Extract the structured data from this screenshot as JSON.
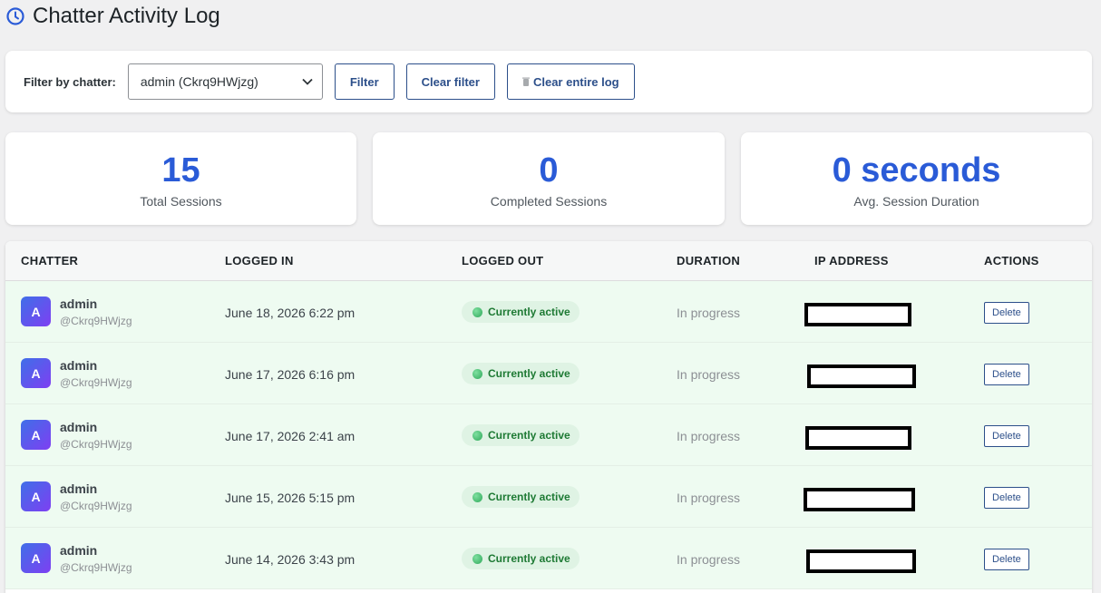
{
  "header": {
    "title": "Chatter Activity Log"
  },
  "filter": {
    "label": "Filter by chatter:",
    "selected": "admin (Ckrq9HWjzg)",
    "filter_button": "Filter",
    "clear_filter_button": "Clear filter",
    "clear_log_button": "Clear entire log"
  },
  "stats": [
    {
      "value": "15",
      "label": "Total Sessions"
    },
    {
      "value": "0",
      "label": "Completed Sessions"
    },
    {
      "value": "0 seconds",
      "label": "Avg. Session Duration"
    }
  ],
  "table": {
    "columns": [
      "CHATTER",
      "LOGGED IN",
      "LOGGED OUT",
      "DURATION",
      "IP ADDRESS",
      "ACTIONS"
    ],
    "rows": [
      {
        "initial": "A",
        "name": "admin",
        "handle": "@Ckrq9HWjzg",
        "logged_in": "June 18, 2026 6:22 pm",
        "status": "Currently active",
        "duration": "In progress",
        "action": "Delete"
      },
      {
        "initial": "A",
        "name": "admin",
        "handle": "@Ckrq9HWjzg",
        "logged_in": "June 17, 2026 6:16 pm",
        "status": "Currently active",
        "duration": "In progress",
        "action": "Delete"
      },
      {
        "initial": "A",
        "name": "admin",
        "handle": "@Ckrq9HWjzg",
        "logged_in": "June 17, 2026 2:41 am",
        "status": "Currently active",
        "duration": "In progress",
        "action": "Delete"
      },
      {
        "initial": "A",
        "name": "admin",
        "handle": "@Ckrq9HWjzg",
        "logged_in": "June 15, 2026 5:15 pm",
        "status": "Currently active",
        "duration": "In progress",
        "action": "Delete"
      },
      {
        "initial": "A",
        "name": "admin",
        "handle": "@Ckrq9HWjzg",
        "logged_in": "June 14, 2026 3:43 pm",
        "status": "Currently active",
        "duration": "In progress",
        "action": "Delete"
      }
    ]
  },
  "colors": {
    "accent": "#2a5bd7",
    "button": "#2c4f8a",
    "active_row": "#eefbf1",
    "active_text": "#1e7a34"
  },
  "icons": {
    "title": "clock-icon",
    "select": "chevron-down-icon",
    "clear_log": "trash-icon",
    "status": "status-dot-icon"
  }
}
